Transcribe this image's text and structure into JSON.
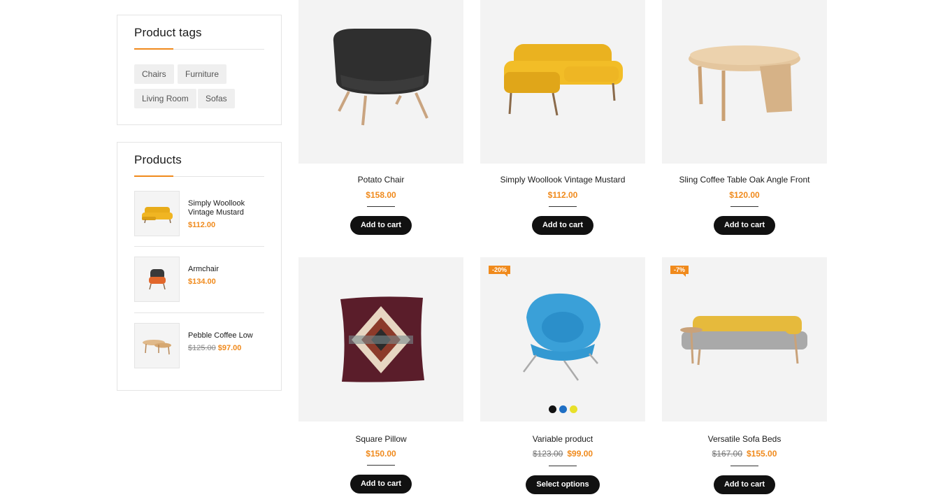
{
  "product_tags": {
    "title": "Product tags",
    "tags": [
      "Chairs",
      "Furniture",
      "Living Room",
      "Sofas"
    ]
  },
  "products_widget": {
    "title": "Products",
    "items": [
      {
        "name": "Simply Woollook Vintage Mustard",
        "price": "$112.00",
        "icon": "yellow-sofa-image"
      },
      {
        "name": "Armchair",
        "price": "$134.00",
        "icon": "armchair-image"
      },
      {
        "name": "Pebble Coffee Low",
        "old_price": "$125.00",
        "price": "$97.00",
        "icon": "coffee-table-image"
      }
    ]
  },
  "grid": {
    "products": [
      {
        "name": "Potato Chair",
        "price": "$158.00",
        "button": "Add to cart",
        "icon": "black-chair-image"
      },
      {
        "name": "Simply Woollook Vintage Mustard",
        "price": "$112.00",
        "button": "Add to cart",
        "icon": "mustard-sofa-image"
      },
      {
        "name": "Sling Coffee Table Oak Angle Front",
        "price": "$120.00",
        "button": "Add to cart",
        "icon": "oak-table-image"
      },
      {
        "name": "Square Pillow",
        "price": "$150.00",
        "button": "Add to cart",
        "icon": "pillow-image"
      },
      {
        "name": "Variable product",
        "old_price": "$123.00",
        "price": "$99.00",
        "button": "Select options",
        "badge": "-20%",
        "icon": "blue-chair-image",
        "swatches": [
          "#111111",
          "#1f6fc4",
          "#e8e02a"
        ]
      },
      {
        "name": "Versatile Sofa Beds",
        "old_price": "$167.00",
        "price": "$155.00",
        "button": "Add to cart",
        "badge": "-7%",
        "icon": "sofa-bed-image"
      }
    ]
  },
  "colors": {
    "accent": "#f08a1c",
    "button": "#111111",
    "card_bg": "#f3f3f3"
  }
}
